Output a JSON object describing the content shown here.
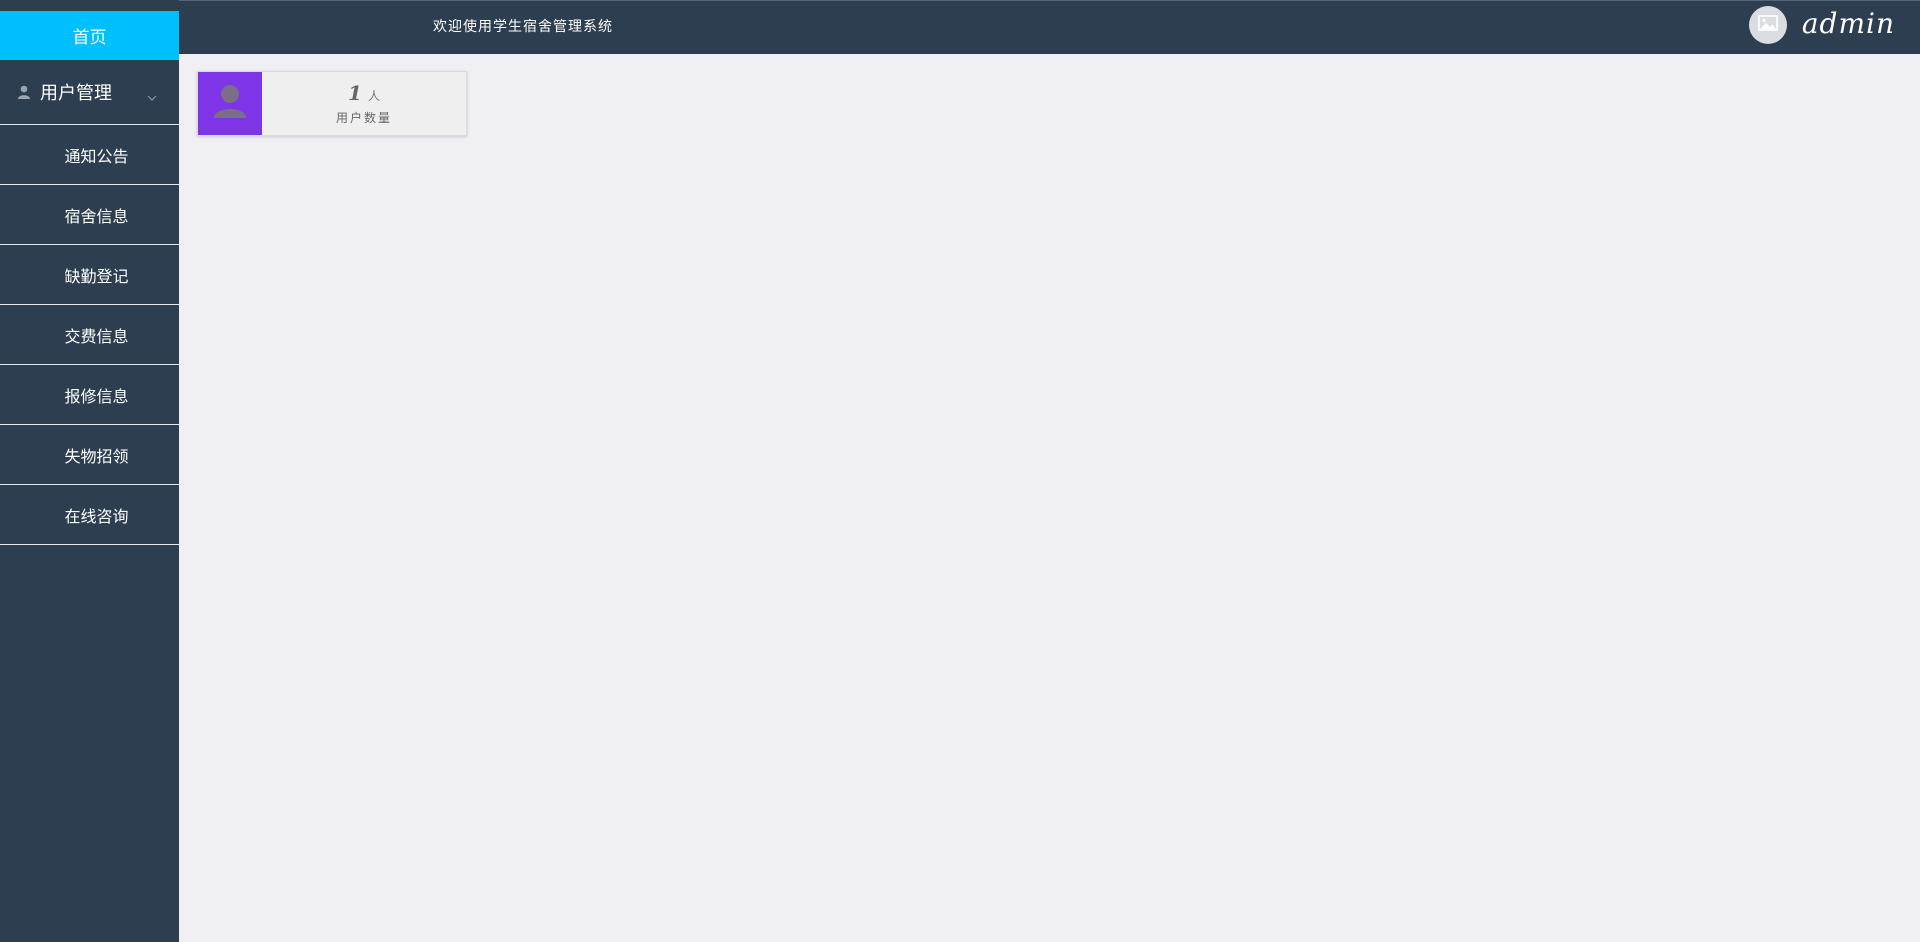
{
  "sidebar": {
    "home_label": "首页",
    "group": {
      "label": "用户管理",
      "icon": "user-icon",
      "expand_icon": "chevron-down-icon"
    },
    "items": [
      {
        "label": "通知公告"
      },
      {
        "label": "宿舍信息"
      },
      {
        "label": "缺勤登记"
      },
      {
        "label": "交费信息"
      },
      {
        "label": "报修信息"
      },
      {
        "label": "失物招领"
      },
      {
        "label": "在线咨询"
      }
    ]
  },
  "header": {
    "title": "欢迎使用学生宿舍管理系统",
    "avatar_icon": "image-placeholder-icon",
    "username": "admin"
  },
  "stats": {
    "user_count": {
      "value": "1",
      "unit": "人",
      "label": "用户数量",
      "icon": "user-icon"
    }
  },
  "colors": {
    "sidebar_bg": "#2c3e50",
    "active_bg": "#00bfff",
    "card_icon_bg": "#7e35e8",
    "page_bg": "#f0eff4"
  }
}
